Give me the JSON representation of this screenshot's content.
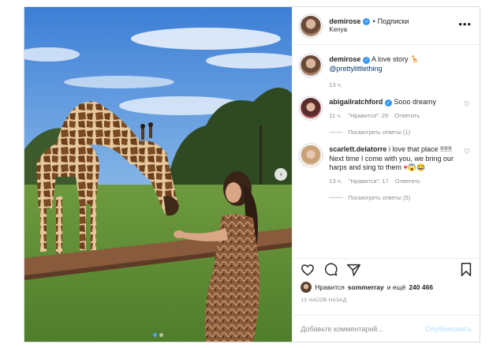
{
  "post": {
    "author": "demirose",
    "follow_bullet": "•",
    "follow_label": "Подписки",
    "location": "Kenya",
    "more_icon": "•••"
  },
  "caption": {
    "username": "demirose",
    "text": "A love story",
    "emoji": "🦒",
    "mention": "@prettylittlething",
    "time": "13 ч."
  },
  "comments": [
    {
      "username": "abigailratchford",
      "text": "Sooo dreamy",
      "time": "11 ч.",
      "likes": "\"Нравится\": 29",
      "reply": "Ответить",
      "view_replies": "Посмотреть ответы (1)"
    },
    {
      "username": "scarlett.delatorre",
      "text": "i love that place !!!!!! Next time I come with you, we bring our harps and sing to them",
      "emojis": "♥😱😂",
      "time": "13 ч.",
      "likes": "\"Нравится\": 17",
      "reply": "Ответить",
      "view_replies": "Посмотреть ответы (5)"
    }
  ],
  "likes": {
    "prefix": "Нравится",
    "user": "sommerray",
    "middle": "и ещё",
    "count": "240 466"
  },
  "time_ago": "13 ЧАСОВ НАЗАД",
  "add_comment": {
    "placeholder": "Добавьте комментарий...",
    "publish": "Опубликовать"
  },
  "icons": {
    "heart": "heart-icon",
    "comment": "comment-icon",
    "share": "paper-plane-icon",
    "bookmark": "bookmark-icon",
    "next": "chevron-right-icon"
  },
  "colors": {
    "verified": "#3897f0",
    "publish_disabled": "#b2dffc",
    "secondary_text": "#8e8e8e",
    "active_dot": "#4da3ff"
  },
  "carousel": {
    "next_glyph": "›",
    "slides": 2,
    "active": 0
  }
}
